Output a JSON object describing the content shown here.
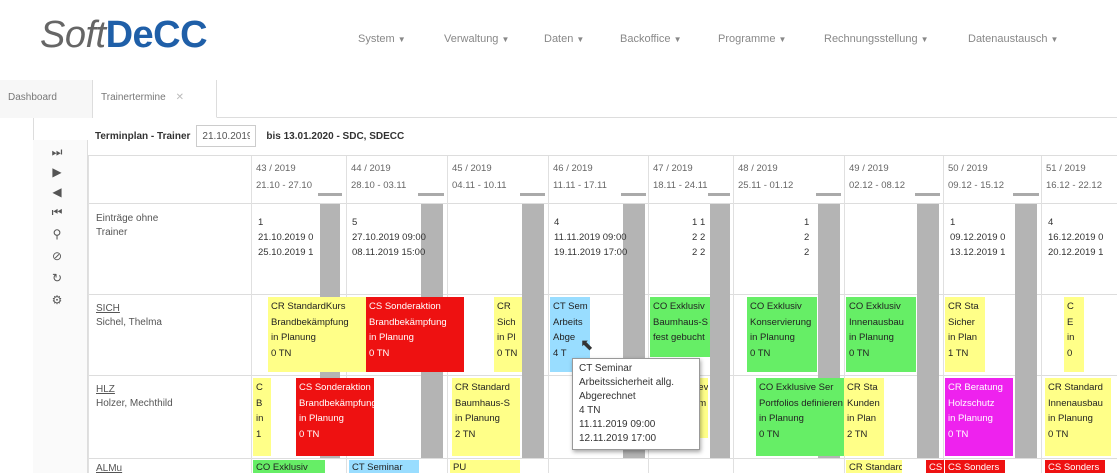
{
  "brand": {
    "part1": "Soft",
    "part2": "DeCC"
  },
  "menu": [
    {
      "label": "System"
    },
    {
      "label": "Verwaltung"
    },
    {
      "label": "Daten"
    },
    {
      "label": "Backoffice"
    },
    {
      "label": "Programme"
    },
    {
      "label": "Rechnungsstellung"
    },
    {
      "label": "Datenaustausch"
    }
  ],
  "tabs": {
    "dashboard": "Dashboard",
    "active": "Trainertermine"
  },
  "plan": {
    "title": "Terminplan - Trainer",
    "from_date": "21.10.2019",
    "until_text": "bis 13.01.2020 - SDC, SDECC"
  },
  "weeks": [
    {
      "kw": "43 / 2019",
      "range": "21.10 - 27.10"
    },
    {
      "kw": "44 / 2019",
      "range": "28.10 - 03.11"
    },
    {
      "kw": "45 / 2019",
      "range": "04.11 - 10.11"
    },
    {
      "kw": "46 / 2019",
      "range": "11.11 - 17.11"
    },
    {
      "kw": "47 / 2019",
      "range": "18.11 - 24.11"
    },
    {
      "kw": "48 / 2019",
      "range": "25.11 - 01.12"
    },
    {
      "kw": "49 / 2019",
      "range": "02.12 - 08.12"
    },
    {
      "kw": "50 / 2019",
      "range": "09.12 - 15.12"
    },
    {
      "kw": "51 / 2019",
      "range": "16.12 - 22.12"
    }
  ],
  "rows": [
    {
      "line1": "Einträge ohne",
      "line2": "Trainer"
    },
    {
      "code": "SICH",
      "name": "Sichel, Thelma"
    },
    {
      "code": "HLZ",
      "name": "Holzer, Mechthild"
    },
    {
      "code": "ALMu",
      "name": ""
    }
  ],
  "unassigned": {
    "w43": [
      "1",
      "21.10.2019 0",
      "25.10.2019 1"
    ],
    "w44": [
      "5",
      "27.10.2019 09:00",
      "08.11.2019 15:00"
    ],
    "w46": [
      "4",
      "11.11.2019 09:00",
      "19.11.2019 17:00"
    ],
    "w47a": [
      "1",
      "2",
      "2"
    ],
    "w47b": [
      "1",
      "2",
      "2"
    ],
    "w48": [
      "1",
      "2",
      "2"
    ],
    "w50": [
      "1",
      "09.12.2019 0",
      "13.12.2019 1"
    ],
    "w51": [
      "4",
      "16.12.2019 0",
      "20.12.2019 1"
    ]
  },
  "events_sich": [
    {
      "lines": [
        "CR StandardKurs",
        "Brandbekämpfung",
        "in Planung",
        "0 TN"
      ]
    },
    {
      "lines": [
        "CS Sonderaktion",
        "Brandbekämpfung",
        "in Planung",
        "0 TN"
      ]
    },
    {
      "lines": [
        "CR",
        "Sich",
        "in Pl",
        "0 TN"
      ]
    },
    {
      "lines": [
        "CT Sem",
        "Arbeits",
        "Abge",
        "4 T"
      ]
    },
    {
      "lines": [
        "CO Exklusiv",
        "Baumhaus-S",
        "fest gebucht",
        ""
      ]
    },
    {
      "lines": [
        "CO Exklusiv",
        "Konservierung",
        "in Planung",
        "0 TN"
      ]
    },
    {
      "lines": [
        "CO Exklusiv",
        "Innenausbau",
        "in Planung",
        "0 TN"
      ]
    },
    {
      "lines": [
        "CR Sta",
        "Sicher",
        "in Plan",
        "1 TN"
      ]
    },
    {
      "lines": [
        "C",
        "E",
        "in",
        "0"
      ]
    }
  ],
  "events_hlz": [
    {
      "lines": [
        "C",
        "B",
        "in",
        "1"
      ]
    },
    {
      "lines": [
        "CS Sonderaktion",
        "Brandbekämpfung",
        "in Planung",
        "0 TN"
      ]
    },
    {
      "lines": [
        "CR Standard",
        "Baumhaus-S",
        "in Planung",
        "2 TN"
      ]
    },
    {
      "lines": [
        "",
        "dev",
        "um",
        "d"
      ]
    },
    {
      "lines": [
        "CO Exklusive Ser",
        "Portfolios definieren",
        "in Planung",
        "0 TN"
      ]
    },
    {
      "lines": [
        "CR Sta",
        "Kunden",
        "in Plan",
        "2 TN"
      ]
    },
    {
      "lines": [
        "CR Beratung",
        "Holzschutz",
        "in Planung",
        "0 TN"
      ]
    },
    {
      "lines": [
        "CR Standard",
        "Innenausbau",
        "in Planung",
        "0 TN"
      ]
    }
  ],
  "events_almu": [
    {
      "lines": [
        "CO Exklusiv"
      ]
    },
    {
      "lines": [
        "CT Seminar"
      ]
    },
    {
      "lines": [
        "PU"
      ]
    },
    {
      "lines": [
        "CR Standard"
      ]
    },
    {
      "lines": [
        "CS"
      ]
    },
    {
      "lines": [
        "CS Sonders"
      ]
    },
    {
      "lines": [
        "CS Sonders"
      ]
    }
  ],
  "tooltip": {
    "lines": [
      "CT Seminar",
      "Arbeitssicherheit allg.",
      "Abgerechnet",
      "4 TN",
      "11.11.2019 09:00",
      "12.11.2019 17:00"
    ]
  },
  "colors": {
    "brand_blue": "#1f5fa8",
    "yellow": "#ffff88",
    "red": "#ee1111",
    "green": "#66ee66",
    "blue": "#99ddff",
    "magenta": "#ee22ee"
  }
}
